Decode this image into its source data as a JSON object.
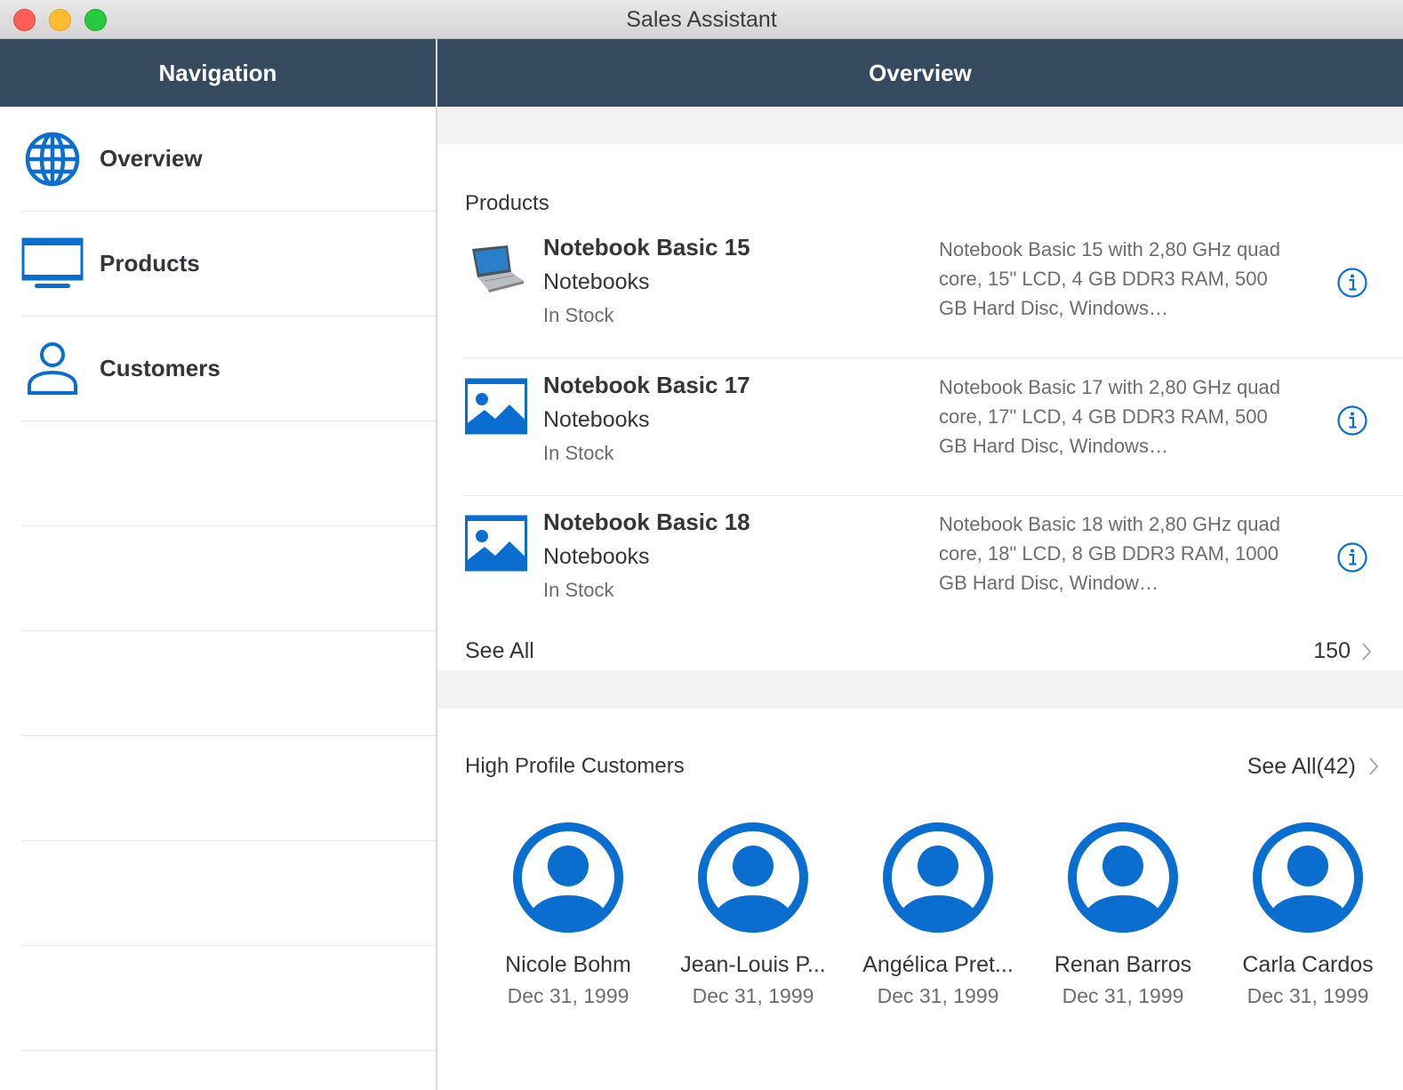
{
  "window": {
    "title": "Sales Assistant"
  },
  "navigation": {
    "header": "Navigation",
    "items": [
      {
        "label": "Overview",
        "icon": "globe-icon"
      },
      {
        "label": "Products",
        "icon": "monitor-icon"
      },
      {
        "label": "Customers",
        "icon": "person-icon"
      }
    ]
  },
  "overview": {
    "header": "Overview",
    "products": {
      "section_title": "Products",
      "items": [
        {
          "name": "Notebook Basic 15",
          "category": "Notebooks",
          "status": "In Stock",
          "description": "Notebook Basic 15 with 2,80 GHz quad core, 15\" LCD, 4 GB DDR3 RAM, 500 GB Hard Disc, Windows…",
          "image": "laptop-photo"
        },
        {
          "name": "Notebook Basic 17",
          "category": "Notebooks",
          "status": "In Stock",
          "description": "Notebook Basic 17 with 2,80 GHz quad core, 17\" LCD, 4 GB DDR3 RAM, 500 GB Hard Disc, Windows…",
          "image": "image-placeholder-icon"
        },
        {
          "name": "Notebook Basic 18",
          "category": "Notebooks",
          "status": "In Stock",
          "description": "Notebook Basic 18 with 2,80 GHz quad core, 18\" LCD, 8 GB DDR3 RAM, 1000 GB Hard Disc, Window…",
          "image": "image-placeholder-icon"
        }
      ],
      "see_all_label": "See All",
      "total_count": "150"
    },
    "customers": {
      "section_title": "High Profile Customers",
      "see_all_label": "See All(42)",
      "items": [
        {
          "name": "Nicole Bohm",
          "date": "Dec 31, 1999"
        },
        {
          "name": "Jean-Louis P...",
          "date": "Dec 31, 1999"
        },
        {
          "name": "Angélica Pret...",
          "date": "Dec 31, 1999"
        },
        {
          "name": "Renan Barros",
          "date": "Dec 31, 1999"
        },
        {
          "name": "Carla Cardos",
          "date": "Dec 31, 1999"
        }
      ]
    }
  },
  "colors": {
    "header_bg": "#354a5f",
    "accent": "#0a6ed1",
    "text": "#32363a",
    "secondary_text": "#6a6d70",
    "group_bg": "#f2f2f2"
  }
}
